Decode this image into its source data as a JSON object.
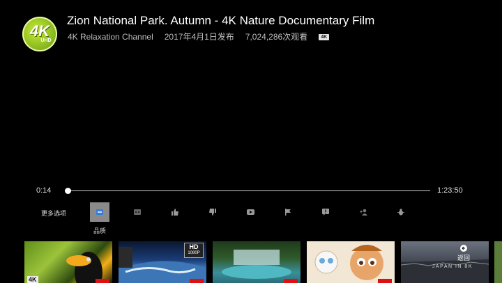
{
  "video": {
    "title": "Zion National Park. Autumn - 4K Nature Documentary Film",
    "channel": "4K Relaxation Channel",
    "published": "2017年4月1日发布",
    "views": "7,024,286次观看",
    "badge": "4K"
  },
  "logo": {
    "main": "4K",
    "sub": "UHD"
  },
  "player": {
    "current_time": "0:14",
    "total_time": "1:23:50",
    "progress_fraction": 0.003
  },
  "controls": {
    "more_options": "更多选项",
    "selected_label": "品质",
    "buttons": [
      "quality-icon",
      "captions-icon",
      "thumbs-up-icon",
      "thumbs-down-icon",
      "youtube-icon",
      "flag-icon",
      "alert-icon",
      "add-user-icon",
      "bug-icon"
    ]
  },
  "related": {
    "hd_badge_main": "HD",
    "hd_badge_sub": "1080P",
    "k4_badge": "4K",
    "japan_text": "JAPAN IN 8K"
  },
  "back": {
    "label": "返回"
  },
  "colors": {
    "progress_track": "#6a6a6a",
    "selected_control": "#8a8a8a",
    "badge_red": "#d11111"
  }
}
